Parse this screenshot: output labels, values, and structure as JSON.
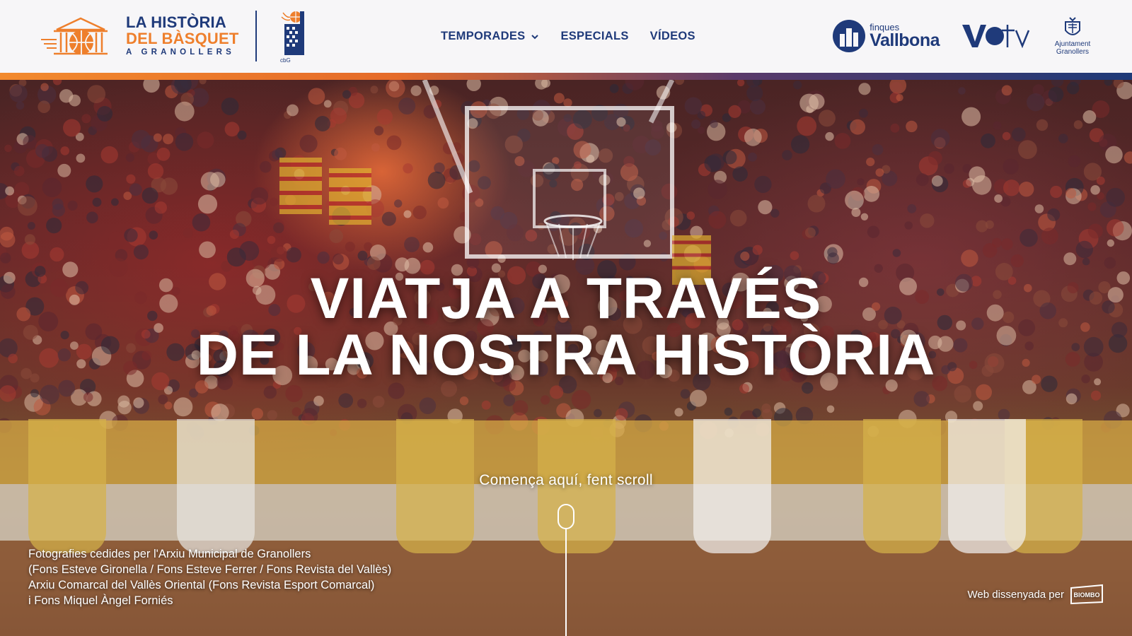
{
  "header": {
    "logo": {
      "line1": "LA HISTÒRIA",
      "line2": "DEL BÀSQUET",
      "line3": "A GRANOLLERS"
    },
    "club_logo_text": "cbG",
    "nav": [
      {
        "label": "TEMPORADES",
        "has_dropdown": true
      },
      {
        "label": "ESPECIALS"
      },
      {
        "label": "VÍDEOS"
      }
    ],
    "sponsors": {
      "vallbona": {
        "small": "finques",
        "big": "Vallbona"
      },
      "votv": "votv",
      "ajuntament": {
        "line1": "Ajuntament",
        "line2": "Granollers"
      }
    }
  },
  "hero": {
    "title_line1": "VIATJA A TRAVÉS",
    "title_line2": "DE LA NOSTRA HISTÒRIA",
    "scroll_hint": "Comença aquí, fent scroll",
    "credits": [
      "Fotografies cedides per l'Arxiu Municipal de Granollers",
      "(Fons Esteve Gironella / Fons Esteve Ferrer / Fons Revista del Vallès)",
      "Arxiu Comarcal del Vallès Oriental (Fons Revista Esport Comarcal)",
      "i Fons Miquel Àngel Forniés"
    ],
    "designed_by": "Web dissenyada per",
    "designer_logo": "BIOMBO"
  },
  "colors": {
    "navy": "#1f3a7a",
    "orange": "#ee7f2c",
    "header_bg": "#f7f6f8"
  }
}
